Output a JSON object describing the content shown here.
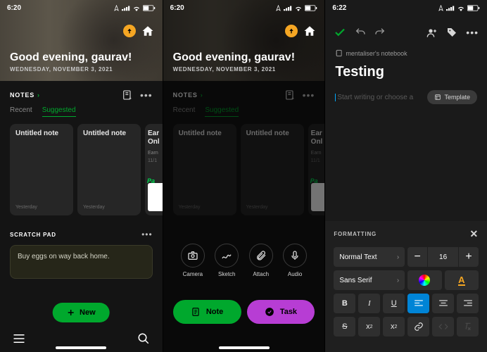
{
  "screen1": {
    "status": {
      "time": "6:20",
      "location_icon": true,
      "signal": true,
      "wifi": true,
      "battery": true
    },
    "hero": {
      "greeting": "Good evening, gaurav!",
      "date": "WEDNESDAY, NOVEMBER 3, 2021"
    },
    "notes": {
      "header": "NOTES",
      "tabs": [
        "Recent",
        "Suggested"
      ],
      "active_tab": 1,
      "cards": [
        {
          "title": "Untitled note",
          "subtitle": "Yesterday"
        },
        {
          "title": "Untitled note",
          "subtitle": "Yesterday"
        }
      ],
      "partial": {
        "title": "Ear",
        "title2": "Onl",
        "sub": "Earn",
        "date": "11/1",
        "promo": "Pa"
      }
    },
    "scratch": {
      "header": "SCRATCH PAD",
      "text": "Buy eggs on way back home."
    },
    "fab": "New"
  },
  "screen2": {
    "status": {
      "time": "6:20"
    },
    "hero": {
      "greeting": "Good evening, gaurav!",
      "date": "WEDNESDAY, NOVEMBER 3, 2021"
    },
    "notes": {
      "header": "NOTES",
      "tabs": [
        "Recent",
        "Suggested"
      ],
      "active_tab": 1,
      "cards": [
        {
          "title": "Untitled note",
          "subtitle": "Yesterday"
        },
        {
          "title": "Untitled note",
          "subtitle": "Yesterday"
        }
      ],
      "partial": {
        "title": "Ear",
        "title2": "Onl",
        "sub": "Earn",
        "date": "11/1",
        "promo": "Pa"
      }
    },
    "actions": [
      {
        "label": "Camera",
        "icon": "camera"
      },
      {
        "label": "Sketch",
        "icon": "sketch"
      },
      {
        "label": "Attach",
        "icon": "attach"
      },
      {
        "label": "Audio",
        "icon": "audio"
      }
    ],
    "pills": {
      "note": "Note",
      "task": "Task"
    }
  },
  "screen3": {
    "status": {
      "time": "6:22"
    },
    "meta": {
      "notebook": "mentaliser's notebook"
    },
    "title": "Testing",
    "placeholder": "Start writing or choose a",
    "template_btn": "Template",
    "formatting": {
      "header": "FORMATTING",
      "style_label": "Normal Text",
      "font_label": "Sans Serif",
      "font_size": "16",
      "buttons": {
        "bold": "B",
        "italic": "I",
        "underline": "U",
        "align_left": "≡",
        "align_center": "≡",
        "align_right": "≡",
        "strike": "S",
        "sup": "x²",
        "sub": "x₂",
        "link": "link",
        "code": "code",
        "clear": "clear"
      }
    }
  }
}
